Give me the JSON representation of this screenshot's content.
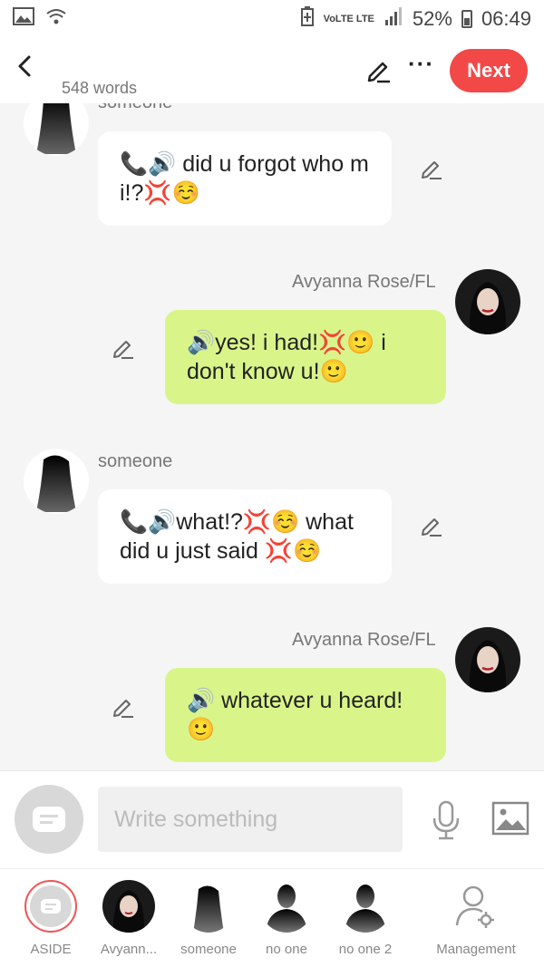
{
  "status": {
    "network": "VoLTE LTE",
    "battery": "52%",
    "time": "06:49"
  },
  "header": {
    "word_count": "548 words",
    "next_label": "Next",
    "more_label": "···"
  },
  "messages": [
    {
      "sender": "someone",
      "text": "📞🔊 did u forgot who m i!?💢☺️"
    },
    {
      "sender": "Avyanna Rose/FL",
      "text": "🔊yes! i had!💢🙂 i don't know u!🙂"
    },
    {
      "sender": "someone",
      "text": "📞🔊what!?💢☺️ what did u just said 💢☺️"
    },
    {
      "sender": "Avyanna Rose/FL",
      "text": "🔊 whatever u heard! 🙂"
    }
  ],
  "composer": {
    "placeholder": "Write something"
  },
  "characters": [
    {
      "label": "ASIDE"
    },
    {
      "label": "Avyann..."
    },
    {
      "label": "someone"
    },
    {
      "label": "no one"
    },
    {
      "label": "no one 2"
    },
    {
      "label": "Management"
    }
  ],
  "colors": {
    "accent": "#f24848",
    "outgoing_bubble": "#d9f58a",
    "incoming_bubble": "#ffffff"
  }
}
